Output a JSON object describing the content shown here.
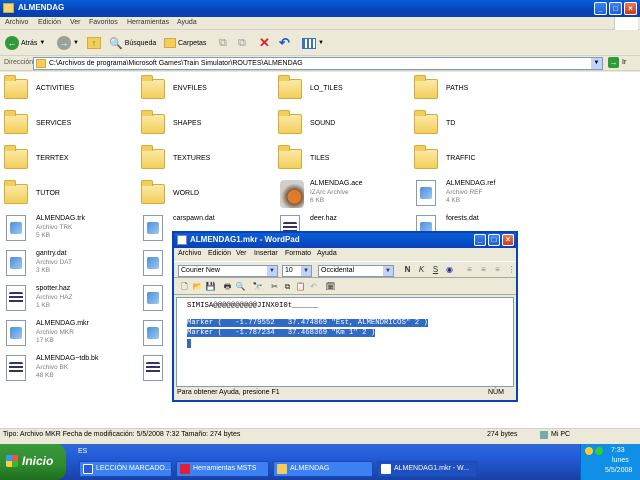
{
  "explorer": {
    "title": "ALMENDAG",
    "menu": [
      "Archivo",
      "Edición",
      "Ver",
      "Favoritos",
      "Herramientas",
      "Ayuda"
    ],
    "toolbar": {
      "back": "Atrás",
      "search": "Búsqueda",
      "folders": "Carpetas"
    },
    "address_label": "Dirección",
    "address_value": "C:\\Archivos de programa\\Microsoft Games\\Train Simulator\\ROUTES\\ALMENDAG",
    "go_label": "Ir",
    "items": [
      {
        "name": "ACTIVITIES",
        "kind": "folder"
      },
      {
        "name": "ENVFILES",
        "kind": "folder"
      },
      {
        "name": "LO_TILES",
        "kind": "folder"
      },
      {
        "name": "PATHS",
        "kind": "folder"
      },
      {
        "name": "SERVICES",
        "kind": "folder"
      },
      {
        "name": "SHAPES",
        "kind": "folder"
      },
      {
        "name": "SOUND",
        "kind": "folder"
      },
      {
        "name": "TD",
        "kind": "folder"
      },
      {
        "name": "TERRTEX",
        "kind": "folder"
      },
      {
        "name": "TEXTURES",
        "kind": "folder"
      },
      {
        "name": "TILES",
        "kind": "folder"
      },
      {
        "name": "TRAFFIC",
        "kind": "folder"
      },
      {
        "name": "TUTOR",
        "kind": "folder"
      },
      {
        "name": "WORLD",
        "kind": "folder"
      },
      {
        "name": "ALMENDAG.ace",
        "type": "IZArc Archive",
        "size": "6 KB",
        "kind": "ace"
      },
      {
        "name": "ALMENDAG.ref",
        "type": "Archivo REF",
        "size": "4 KB",
        "kind": "doc"
      },
      {
        "name": "ALMENDAG.trk",
        "type": "Archivo TRK",
        "size": "5 KB",
        "kind": "doc"
      },
      {
        "name": "carspawn.dat",
        "type": "",
        "size": "",
        "kind": "doc"
      },
      {
        "name": "deer.haz",
        "type": "",
        "size": "",
        "kind": "grid"
      },
      {
        "name": "forests.dat",
        "type": "",
        "size": "",
        "kind": "doc"
      },
      {
        "name": "gantry.dat",
        "type": "Archivo DAT",
        "size": "3 KB",
        "kind": "doc"
      },
      {
        "name": "spotter.haz",
        "type": "Archivo HAZ",
        "size": "1 KB",
        "kind": "grid"
      },
      {
        "name": "ALMENDAG.mkr",
        "type": "Archivo MKR",
        "size": "17 KB",
        "kind": "doc"
      },
      {
        "name": "ALMENDAG~tdb.bk",
        "type": "Archivo BK",
        "size": "48 KB",
        "kind": "grid"
      }
    ],
    "status_left": "Tipo: Archivo MKR Fecha de modificación: 5/5/2008 7:32 Tamaño: 274 bytes",
    "status_size": "274 bytes",
    "status_zone": "Mi PC"
  },
  "wordpad": {
    "title": "ALMENDAG1.mkr - WordPad",
    "menu": [
      "Archivo",
      "Edición",
      "Ver",
      "Insertar",
      "Formato",
      "Ayuda"
    ],
    "font": "Courier New",
    "size": "10",
    "script": "Occidental",
    "lines": [
      "SIMISA@@@@@@@@@@JINX0I0t______",
      "Marker (   -1.779552   37.474869 \"Est, ALMENDRICOS\" 2 )",
      "Marker (   -1.787234   37.468369 \"Km 1\" 2 )"
    ],
    "status": "Para obtener Ayuda, presione F1",
    "num": "NÚM"
  },
  "taskbar": {
    "start": "Inicio",
    "lang": "ES",
    "tasks": [
      "LECCIÓN MARCADO...",
      "Herramientas MSTS",
      "ALMENDAG",
      "ALMENDAG1.mkr - W..."
    ],
    "time": "7:33",
    "day": "lunes",
    "date": "5/5/2008"
  }
}
